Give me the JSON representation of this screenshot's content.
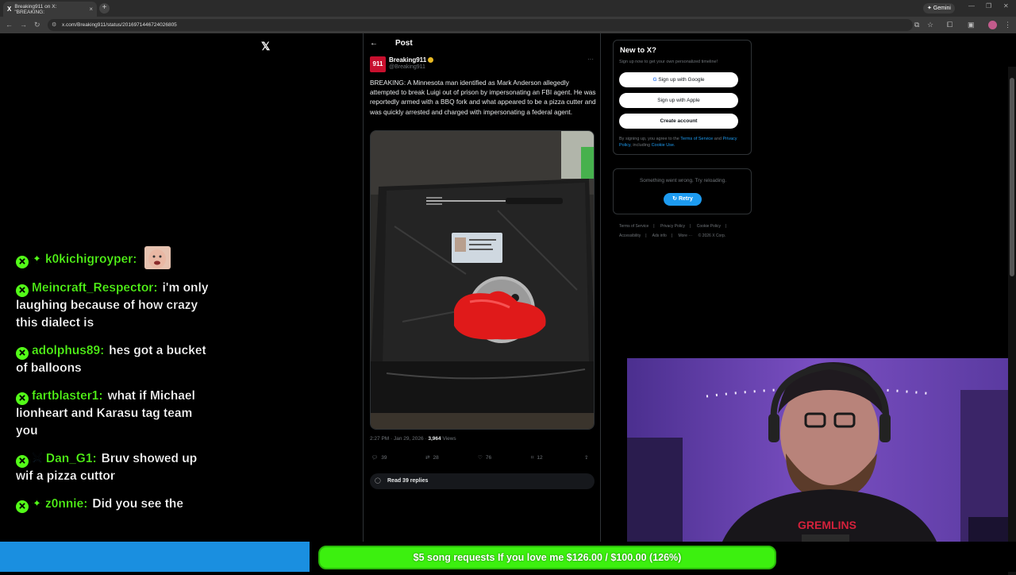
{
  "browser": {
    "tab_title": "Breaking911 on X: \"BREAKING:",
    "tab_close": "×",
    "new_tab": "+",
    "gemini_label": "✦ Gemini",
    "url": "x.com/Breaking911/status/2016971446724026805"
  },
  "x": {
    "logo": "𝕏",
    "header_title": "Post",
    "back": "←",
    "author": {
      "avatar_text": "911",
      "name": "Breaking911",
      "handle": "@Breaking911"
    },
    "more": "···",
    "post_text": "BREAKING: A Minnesota man identified as Mark Anderson allegedly attempted to break Luigi out of prison by impersonating an FBI agent. He was reportedly armed with a BBQ fork and what appeared to be a pizza cutter and was quickly arrested and charged with impersonating a federal agent.",
    "timestamp": "2:27 PM · Jan 29, 2026 · ",
    "views_count": "3,964",
    "views_label": " Views",
    "actions": {
      "replies": "39",
      "reposts": "28",
      "likes": "76",
      "bookmarks": "12"
    },
    "read_replies": "Read 39 replies"
  },
  "sidebar": {
    "new_to_x": "New to X?",
    "subtitle": "Sign up now to get your own personalized timeline!",
    "google": "Sign up with Google",
    "apple": "Sign up with Apple",
    "create": "Create account",
    "legal_prefix": "By signing up, you agree to the ",
    "terms": "Terms of Service",
    "and": " and ",
    "privacy": "Privacy Policy",
    "including": ", including ",
    "cookie": "Cookie Use.",
    "error_msg": "Something went wrong. Try reloading.",
    "retry": "Retry",
    "footer": [
      "Terms of Service",
      "|",
      "Privacy Policy",
      "|",
      "Cookie Policy",
      "|",
      "Accessibility",
      "|",
      "Ads info",
      "|",
      "More ···",
      "© 2026 X Corp."
    ]
  },
  "chat": [
    {
      "user": "k0kichigroyper:",
      "message": ""
    },
    {
      "user": "Meincraft_Respector:",
      "message": "i'm only laughing because of how crazy this dialect is"
    },
    {
      "user": "adolphus89:",
      "message": "hes got a bucket of balloons"
    },
    {
      "user": "fartblaster1:",
      "message": "what if Michael lionheart and Karasu tag team you"
    },
    {
      "user": "Dan_G1:",
      "message": "Bruv showed up wif a pizza cuttor"
    },
    {
      "user": "z0nnie:",
      "message": "Did you see the"
    }
  ],
  "overlay": {
    "goal_text": "$5 song requests If you love me $126.00 / $100.00 (126%)",
    "goal_progress": 1.26,
    "hoodie_text": "GREMLINS"
  },
  "colors": {
    "x_blue": "#1d9bf0",
    "chat_green": "#53fc18",
    "goal_green": "#3cf00f"
  }
}
